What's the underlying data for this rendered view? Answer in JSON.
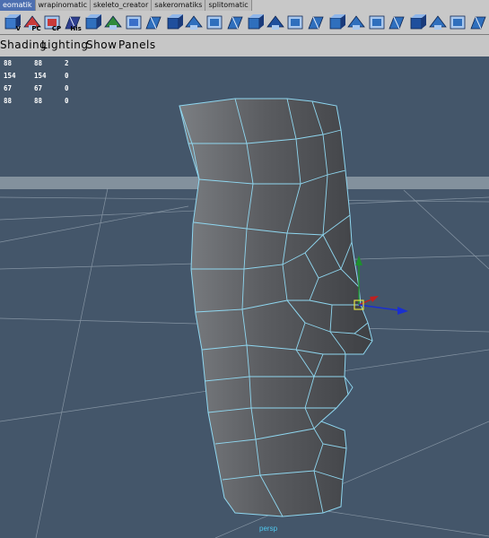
{
  "shelf_tabs": [
    "eomatik",
    "wrapinomatic",
    "skeleto_creator",
    "sakeromatiks",
    "splitomatic"
  ],
  "shelf_icons": [
    {
      "name": "shelf-v-icon",
      "label": "V",
      "color": "#3a78c9"
    },
    {
      "name": "shelf-pc-icon",
      "label": "PC",
      "color": "#c83a3a"
    },
    {
      "name": "shelf-cp-icon",
      "label": "CP",
      "color": "#c83a3a"
    },
    {
      "name": "shelf-his-icon",
      "label": "His",
      "color": "#2f3f8f"
    },
    {
      "name": "shelf-poly-cube-icon",
      "label": "",
      "color": "#2f6fbd"
    },
    {
      "name": "shelf-poly-paint-icon",
      "label": "",
      "color": "#2f8a3a"
    },
    {
      "name": "shelf-poly-tool-icon",
      "label": "",
      "color": "#3a6fc9"
    },
    {
      "name": "shelf-poly-cut-icon",
      "label": "",
      "color": "#2f6fbd"
    },
    {
      "name": "shelf-extrude-icon",
      "label": "",
      "color": "#1f4f9d"
    },
    {
      "name": "shelf-merge-icon",
      "label": "",
      "color": "#2f6fbd"
    },
    {
      "name": "shelf-split-icon",
      "label": "",
      "color": "#2f6fbd"
    },
    {
      "name": "shelf-bridge-icon",
      "label": "",
      "color": "#2f6fbd"
    },
    {
      "name": "shelf-bevel-icon",
      "label": "",
      "color": "#2f6fbd"
    },
    {
      "name": "shelf-smooth-icon",
      "label": "",
      "color": "#1f4f9d"
    },
    {
      "name": "shelf-mirror-icon",
      "label": "",
      "color": "#2f6fbd"
    },
    {
      "name": "shelf-combine-icon",
      "label": "",
      "color": "#2f6fbd"
    },
    {
      "name": "shelf-separate-icon",
      "label": "",
      "color": "#2f6fbd"
    },
    {
      "name": "shelf-sculpt-icon",
      "label": "",
      "color": "#2f6fbd"
    },
    {
      "name": "shelf-wedge-icon",
      "label": "",
      "color": "#2f6fbd"
    },
    {
      "name": "shelf-poke-icon",
      "label": "",
      "color": "#2f6fbd"
    },
    {
      "name": "shelf-append-icon",
      "label": "",
      "color": "#1f4f9d"
    },
    {
      "name": "shelf-fill-icon",
      "label": "",
      "color": "#2f6fbd"
    },
    {
      "name": "shelf-reduce-icon",
      "label": "",
      "color": "#2f6fbd"
    },
    {
      "name": "shelf-cleanup-icon",
      "label": "",
      "color": "#2f6fbd"
    }
  ],
  "panel_menu": [
    "Shading",
    "Lighting",
    "Show",
    "Panels"
  ],
  "hud_rows": [
    [
      "88",
      "88",
      "2"
    ],
    [
      "154",
      "154",
      "0"
    ],
    [
      "67",
      "67",
      "0"
    ],
    [
      "88",
      "88",
      "0"
    ]
  ],
  "camera_label": "persp",
  "colors": {
    "viewport_bg": "#44566a",
    "wireframe": "#8fd7f0",
    "mesh_fill": "#5b5d60",
    "grid": "#9aa8b5",
    "manip_y": "#1f8f2f",
    "manip_x": "#c02020",
    "manip_z": "#1a2fd0",
    "manip_center": "#e0e040"
  }
}
